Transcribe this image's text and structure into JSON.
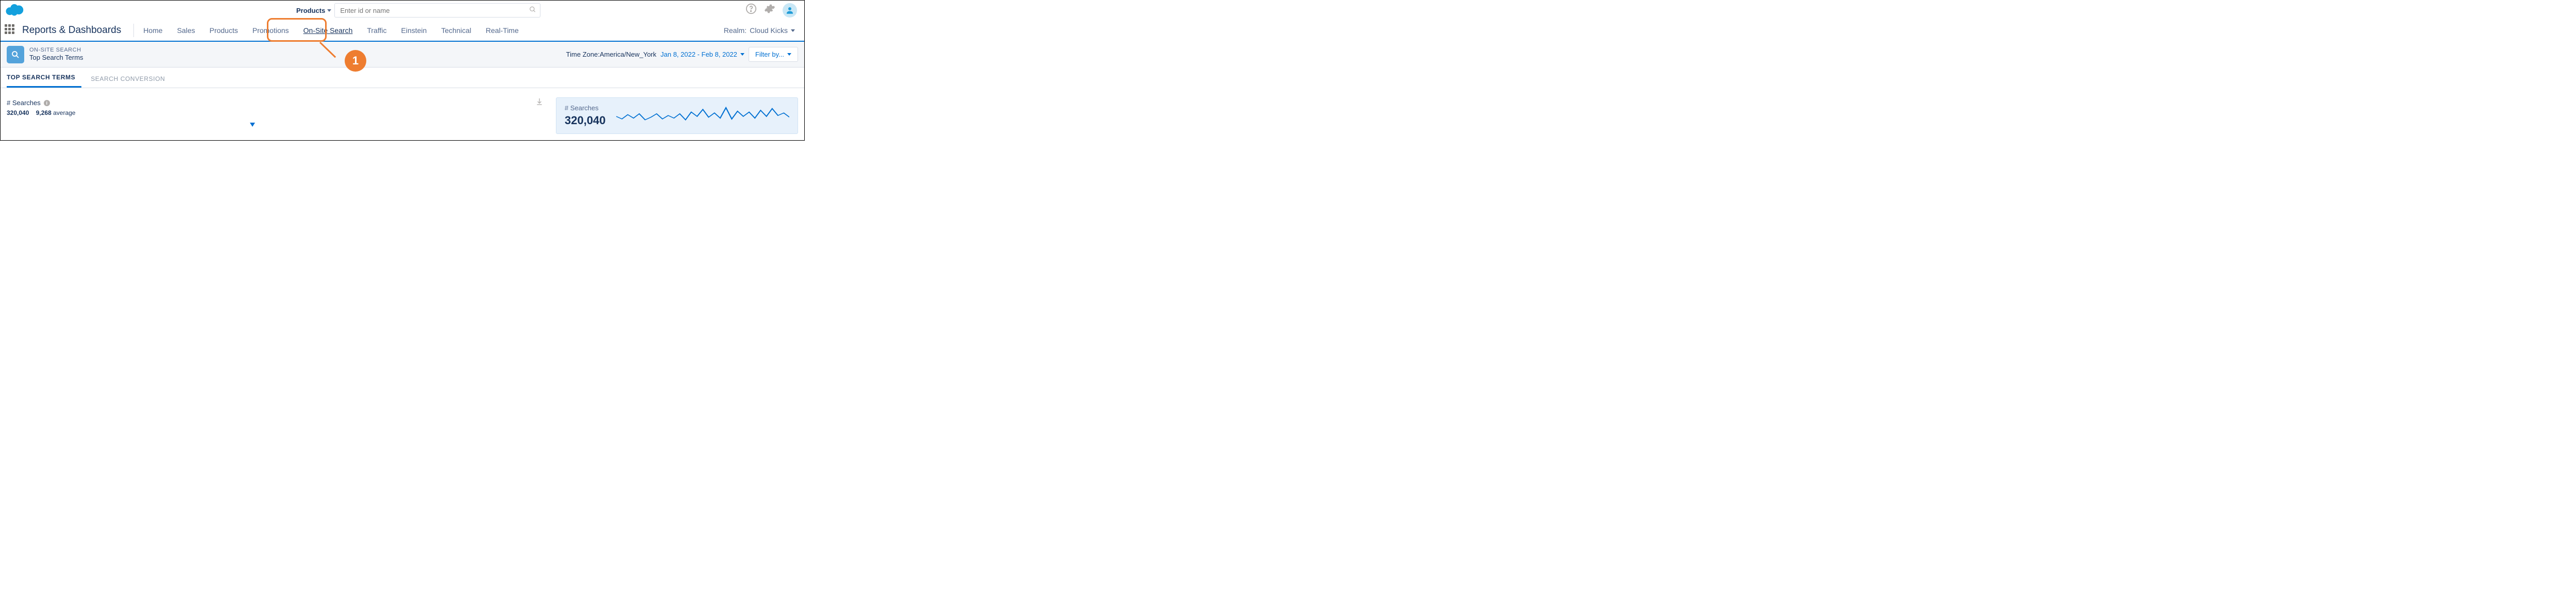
{
  "header": {
    "products_selector_label": "Products",
    "search_placeholder": "Enter id or name"
  },
  "nav": {
    "app_title": "Reports & Dashboards",
    "tabs": [
      "Home",
      "Sales",
      "Products",
      "Promotions",
      "On-Site Search",
      "Traffic",
      "Einstein",
      "Technical",
      "Real-Time"
    ],
    "active_tab_index": 4,
    "realm_label": "Realm:",
    "realm_value": "Cloud Kicks"
  },
  "callout": {
    "number": "1"
  },
  "subheader": {
    "kicker": "ON-SITE SEARCH",
    "title": "Top Search Terms",
    "timezone_label": "Time Zone:",
    "timezone_value": "America/New_York",
    "date_range": "Jan 8, 2022 - Feb 8, 2022",
    "filter_label": "Filter by..."
  },
  "page_tabs": {
    "items": [
      "TOP SEARCH TERMS",
      "SEARCH CONVERSION"
    ],
    "active_index": 0
  },
  "main": {
    "stat_title": "# Searches",
    "total": "320,040",
    "average": "9,268",
    "average_suffix": "average"
  },
  "card": {
    "kicker": "# Searches",
    "value": "320,040"
  },
  "chart_data": {
    "type": "line",
    "title": "# Searches sparkline",
    "series": [
      {
        "name": "searches",
        "values": [
          24,
          18,
          28,
          20,
          30,
          16,
          22,
          30,
          18,
          26,
          20,
          30,
          16,
          34,
          24,
          40,
          22,
          32,
          20,
          44,
          18,
          36,
          24,
          34,
          20,
          38,
          24,
          42,
          26,
          32,
          22
        ]
      }
    ],
    "ylim": [
      0,
      50
    ]
  }
}
